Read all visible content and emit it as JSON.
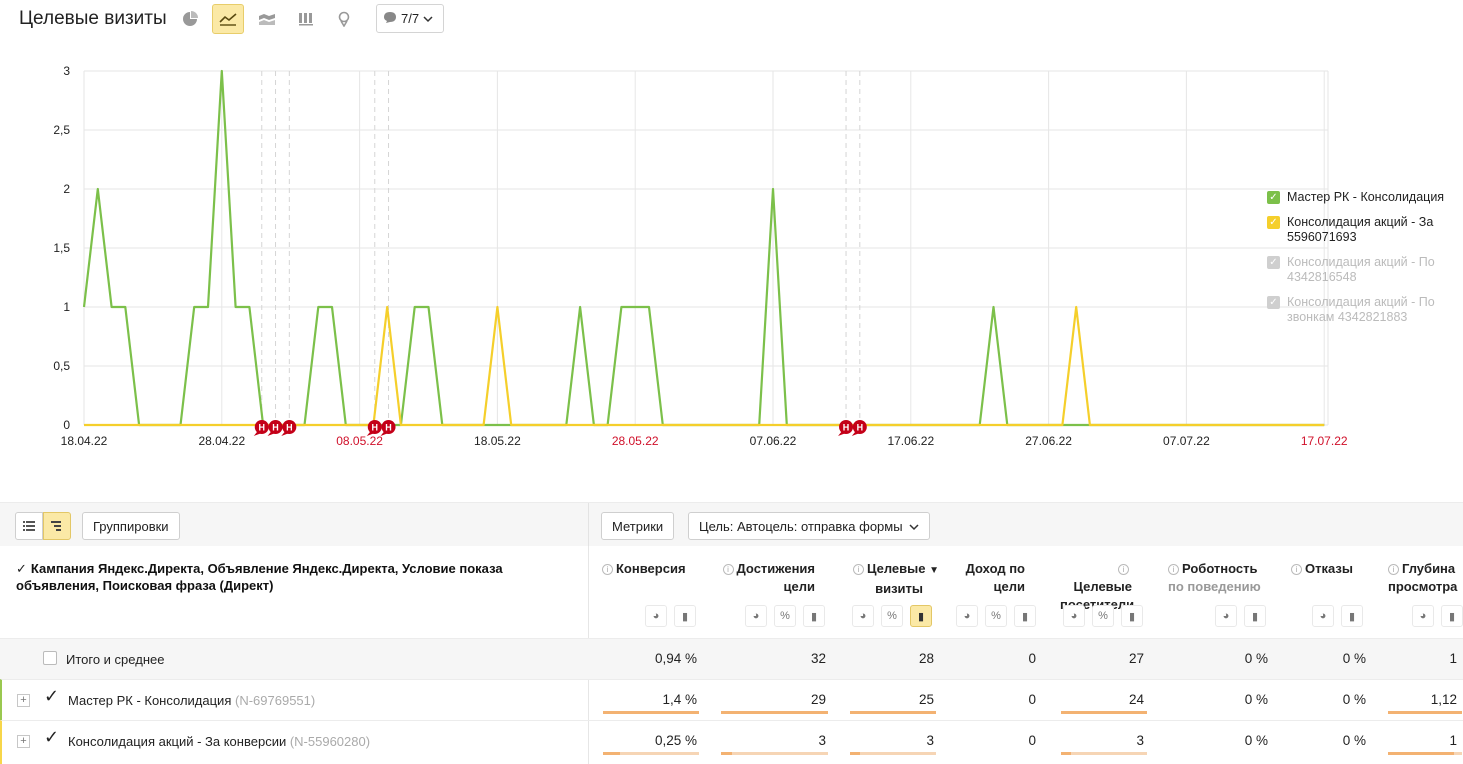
{
  "header": {
    "title": "Целевые визиты",
    "annotations_label": "7/7",
    "view_buttons": [
      "pie-chart-icon",
      "line-chart-icon",
      "stacked-area-icon",
      "bar-chart-icon",
      "map-pin-icon"
    ],
    "active_view": "line-chart-icon"
  },
  "chart_data": {
    "type": "line",
    "x": [
      "18.04.22",
      "19.04.22",
      "20.04.22",
      "21.04.22",
      "22.04.22",
      "23.04.22",
      "24.04.22",
      "25.04.22",
      "26.04.22",
      "27.04.22",
      "28.04.22",
      "29.04.22",
      "30.04.22",
      "01.05.22",
      "02.05.22",
      "03.05.22",
      "04.05.22",
      "05.05.22",
      "06.05.22",
      "07.05.22",
      "08.05.22",
      "09.05.22",
      "10.05.22",
      "11.05.22",
      "12.05.22",
      "13.05.22",
      "14.05.22",
      "15.05.22",
      "16.05.22",
      "17.05.22",
      "18.05.22",
      "19.05.22",
      "20.05.22",
      "21.05.22",
      "22.05.22",
      "23.05.22",
      "24.05.22",
      "25.05.22",
      "26.05.22",
      "27.05.22",
      "28.05.22",
      "29.05.22",
      "30.05.22",
      "31.05.22",
      "01.06.22",
      "02.06.22",
      "03.06.22",
      "04.06.22",
      "05.06.22",
      "06.06.22",
      "07.06.22",
      "08.06.22",
      "09.06.22",
      "10.06.22",
      "11.06.22",
      "12.06.22",
      "13.06.22",
      "14.06.22",
      "15.06.22",
      "16.06.22",
      "17.06.22",
      "18.06.22",
      "19.06.22",
      "20.06.22",
      "21.06.22",
      "22.06.22",
      "23.06.22",
      "24.06.22",
      "25.06.22",
      "26.06.22",
      "27.06.22",
      "28.06.22",
      "29.06.22",
      "30.06.22",
      "01.07.22",
      "02.07.22",
      "03.07.22",
      "04.07.22",
      "05.07.22",
      "06.07.22",
      "07.07.22",
      "08.07.22",
      "09.07.22",
      "10.07.22",
      "11.07.22",
      "12.07.22",
      "13.07.22",
      "14.07.22",
      "15.07.22",
      "16.07.22",
      "17.07.22",
      "18.07.22",
      "19.07.22",
      "20.07.22",
      "21.07.22",
      "22.07.22"
    ],
    "series": [
      {
        "name": "Мастер РК - Консолидация",
        "color": "#7cc04a",
        "values": [
          1,
          2,
          1,
          1,
          0,
          0,
          0,
          0,
          1,
          1,
          3,
          1,
          1,
          0,
          0,
          0,
          0,
          1,
          1,
          0,
          0,
          0,
          0,
          0,
          1,
          1,
          0,
          0,
          0,
          0,
          0,
          0,
          0,
          0,
          0,
          0,
          1,
          0,
          0,
          1,
          1,
          1,
          0,
          0,
          0,
          0,
          0,
          0,
          0,
          0,
          2,
          0,
          0,
          0,
          0,
          0,
          0,
          0,
          0,
          0,
          0,
          0,
          0,
          0,
          0,
          0,
          1,
          0,
          0,
          0,
          0,
          0,
          0,
          0,
          0,
          0,
          0,
          0,
          0,
          0,
          0,
          0,
          0,
          0,
          0,
          0,
          0,
          0,
          0,
          0,
          0,
          0,
          0,
          0,
          0,
          0
        ]
      },
      {
        "name": "Консолидация акций - За конверсии",
        "color": "#f5cf2b",
        "values": [
          0,
          0,
          0,
          0,
          0,
          0,
          0,
          0,
          0,
          0,
          0,
          0,
          0,
          0,
          0,
          0,
          0,
          0,
          0,
          0,
          0,
          0,
          1,
          0,
          0,
          0,
          0,
          0,
          0,
          0,
          1,
          0,
          0,
          0,
          0,
          0,
          0,
          0,
          0,
          0,
          0,
          0,
          0,
          0,
          0,
          0,
          0,
          0,
          0,
          0,
          0,
          0,
          0,
          0,
          0,
          0,
          0,
          0,
          0,
          0,
          0,
          0,
          0,
          0,
          0,
          0,
          0,
          0,
          0,
          0,
          0,
          0,
          1,
          0,
          0,
          0,
          0,
          0,
          0,
          0,
          0,
          0,
          0,
          0,
          0,
          0,
          0,
          0,
          0,
          0,
          0,
          0,
          0,
          0,
          0,
          0
        ]
      },
      {
        "name": "Консолидация акций - По 4342816548",
        "color": "#7fb2e5",
        "values": [
          0,
          0,
          0,
          0,
          0,
          0,
          0,
          0,
          0,
          0,
          0,
          0,
          0,
          0,
          0,
          0,
          0,
          0,
          0,
          0,
          0,
          0,
          0,
          0,
          0,
          0,
          0,
          0,
          0,
          0,
          0,
          0,
          0,
          0,
          0,
          0,
          0,
          0,
          0,
          0,
          0,
          0,
          0,
          0,
          0,
          0,
          0,
          0,
          0,
          0,
          0,
          0,
          0,
          0,
          0,
          0,
          0,
          0,
          0,
          0,
          0,
          0,
          0,
          0,
          0,
          0,
          0,
          0,
          0,
          0,
          0,
          0,
          0,
          0,
          0,
          0,
          0,
          0,
          0,
          0,
          0,
          0,
          0,
          0,
          0,
          0,
          0,
          0,
          0,
          0,
          0,
          0,
          0,
          0,
          0,
          0
        ]
      }
    ],
    "xticks": [
      {
        "label": "18.04.22",
        "i": 0,
        "red": false
      },
      {
        "label": "28.04.22",
        "i": 10,
        "red": false
      },
      {
        "label": "08.05.22",
        "i": 20,
        "red": true
      },
      {
        "label": "18.05.22",
        "i": 30,
        "red": false
      },
      {
        "label": "28.05.22",
        "i": 40,
        "red": true
      },
      {
        "label": "07.06.22",
        "i": 50,
        "red": false
      },
      {
        "label": "17.06.22",
        "i": 60,
        "red": false
      },
      {
        "label": "27.06.22",
        "i": 70,
        "red": false
      },
      {
        "label": "07.07.22",
        "i": 80,
        "red": false
      },
      {
        "label": "17.07.22",
        "i": 90,
        "red": true
      }
    ],
    "yticks": [
      "0",
      "0,5",
      "1",
      "1,5",
      "2",
      "2,5",
      "3"
    ],
    "ylim": [
      0,
      3
    ],
    "annotation_markers": [
      {
        "label": "Н",
        "i": 12.9
      },
      {
        "label": "Н",
        "i": 13.9
      },
      {
        "label": "Н",
        "i": 14.9
      },
      {
        "label": "Н",
        "i": 21.1
      },
      {
        "label": "Н",
        "i": 22.1
      },
      {
        "label": "Н",
        "i": 55.3
      },
      {
        "label": "Н",
        "i": 56.3
      }
    ],
    "grid": true
  },
  "legend": [
    {
      "label": "Мастер РК - Консолидация",
      "color": "#7cc04a",
      "enabled": true
    },
    {
      "label": "Консолидация акций - За 5596071693",
      "color": "#f5cf2b",
      "enabled": true
    },
    {
      "label": "Консолидация акций - По 4342816548",
      "color": "#cfcfcf",
      "enabled": false
    },
    {
      "label": "Консолидация акций - По звонкам 4342821883",
      "color": "#cfcfcf",
      "enabled": false
    }
  ],
  "toolbar": {
    "groupings_label": "Группировки",
    "metrics_label": "Метрики",
    "goal_label": "Цель: Автоцель: отправка формы"
  },
  "table": {
    "dimension_header": "Кампания Яндекс.Директа, Объявление Яндекс.Директа, Условие показа объявления, Поисковая фраза (Директ)",
    "columns": [
      {
        "line1": "Конверсия",
        "line2": ""
      },
      {
        "line1": "Достижения",
        "line2": "цели"
      },
      {
        "line1": "Целевые",
        "line2": "визиты"
      },
      {
        "line1": "Доход по",
        "line2": "цели"
      },
      {
        "line1": "Целевые",
        "line2": "посетители"
      },
      {
        "line1": "Роботность",
        "line2": "по поведению"
      },
      {
        "line1": "Отказы",
        "line2": ""
      },
      {
        "line1": "Глубина",
        "line2": "просмотра"
      }
    ],
    "sort_arrow": "▼",
    "total": {
      "label": "Итого и среднее",
      "values": [
        "0,94 %",
        "32",
        "28",
        "0",
        "27",
        "0 %",
        "0 %",
        "1"
      ]
    },
    "rows": [
      {
        "label": "Мастер РК - Консолидация",
        "id": "(N-69769551)",
        "values": [
          "1,4 %",
          "29",
          "25",
          "0",
          "24",
          "0 %",
          "0 %",
          "1,12"
        ],
        "bars": [
          1,
          1,
          1,
          null,
          1,
          null,
          null,
          1
        ]
      },
      {
        "label": "Консолидация акций - За конверсии",
        "id": "(N-55960280)",
        "values": [
          "0,25 %",
          "3",
          "3",
          "0",
          "3",
          "0 %",
          "0 %",
          "1"
        ],
        "bars": [
          0.18,
          0.1,
          0.12,
          null,
          0.12,
          null,
          null,
          0.89
        ]
      }
    ]
  }
}
